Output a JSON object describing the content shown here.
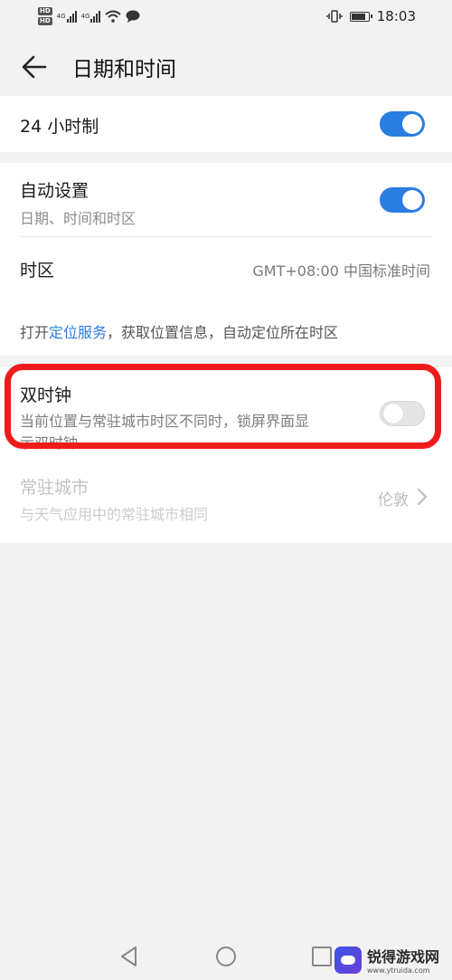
{
  "status_bar": {
    "hd1": "HD",
    "hd2": "HD",
    "net1": "4G",
    "net2": "4G",
    "time": "18:03",
    "battery_level": 0.9
  },
  "header": {
    "title": "日期和时间"
  },
  "rows": {
    "hour24": {
      "label": "24 小时制",
      "enabled": true
    },
    "auto": {
      "label": "自动设置",
      "sub": "日期、时间和时区",
      "enabled": true
    },
    "timezone": {
      "label": "时区",
      "value": "GMT+08:00 中国标准时间"
    },
    "hint": {
      "prefix": "打开",
      "link": "定位服务",
      "suffix": "，获取位置信息，自动定位所在时区"
    },
    "dual_clock": {
      "label": "双时钟",
      "sub_line1": "当前位置与常驻城市时区不同时，锁屏界面显",
      "sub_line2": "示双时钟",
      "enabled": false
    },
    "home_city": {
      "label": "常驻城市",
      "sub": "与天气应用中的常驻城市相同",
      "value": "伦敦"
    }
  },
  "watermark": {
    "title": "锐得游戏网",
    "url": "www.ytruida.com"
  },
  "colors": {
    "accent": "#2a7de1",
    "highlight": "#ee1b1b",
    "background": "#f2f2f2"
  },
  "icons": [
    "back-arrow-icon",
    "chevron-right-icon",
    "nav-back-icon",
    "nav-home-icon",
    "nav-recent-icon",
    "wifi-icon",
    "chat-icon",
    "vibrate-icon",
    "battery-icon"
  ]
}
